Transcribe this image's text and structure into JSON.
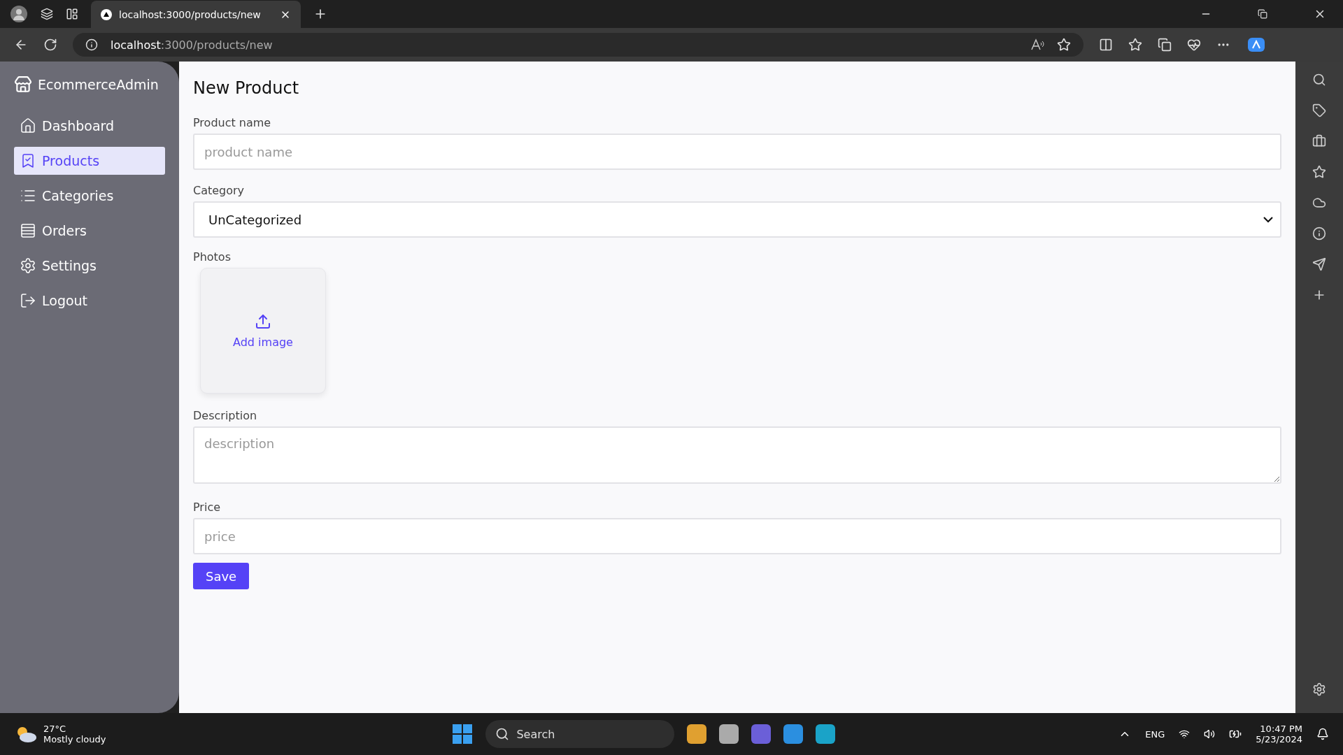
{
  "browser": {
    "tab_title": "localhost:3000/products/new",
    "address": {
      "host": "localhost",
      "path": ":3000/products/new"
    }
  },
  "sidebar": {
    "brand": "EcommerceAdmin",
    "items": [
      {
        "kind": "home",
        "label": "Dashboard",
        "selected": false
      },
      {
        "kind": "products",
        "label": "Products",
        "selected": true
      },
      {
        "kind": "list",
        "label": "Categories",
        "selected": false
      },
      {
        "kind": "orders",
        "label": "Orders",
        "selected": false
      },
      {
        "kind": "settings",
        "label": "Settings",
        "selected": false
      },
      {
        "kind": "logout",
        "label": "Logout",
        "selected": false
      }
    ]
  },
  "form": {
    "title": "New Product",
    "name": {
      "label": "Product name",
      "placeholder": "product name"
    },
    "category": {
      "label": "Category",
      "value": "UnCategorized"
    },
    "photos": {
      "label": "Photos",
      "add": "Add image"
    },
    "description": {
      "label": "Description",
      "placeholder": "description"
    },
    "price": {
      "label": "Price",
      "placeholder": "price"
    },
    "save": "Save"
  },
  "taskbar": {
    "temperature": "27°C",
    "weather": "Mostly cloudy",
    "search": "Search",
    "language": "ENG",
    "time": "10:47 PM",
    "date": "5/23/2024"
  }
}
